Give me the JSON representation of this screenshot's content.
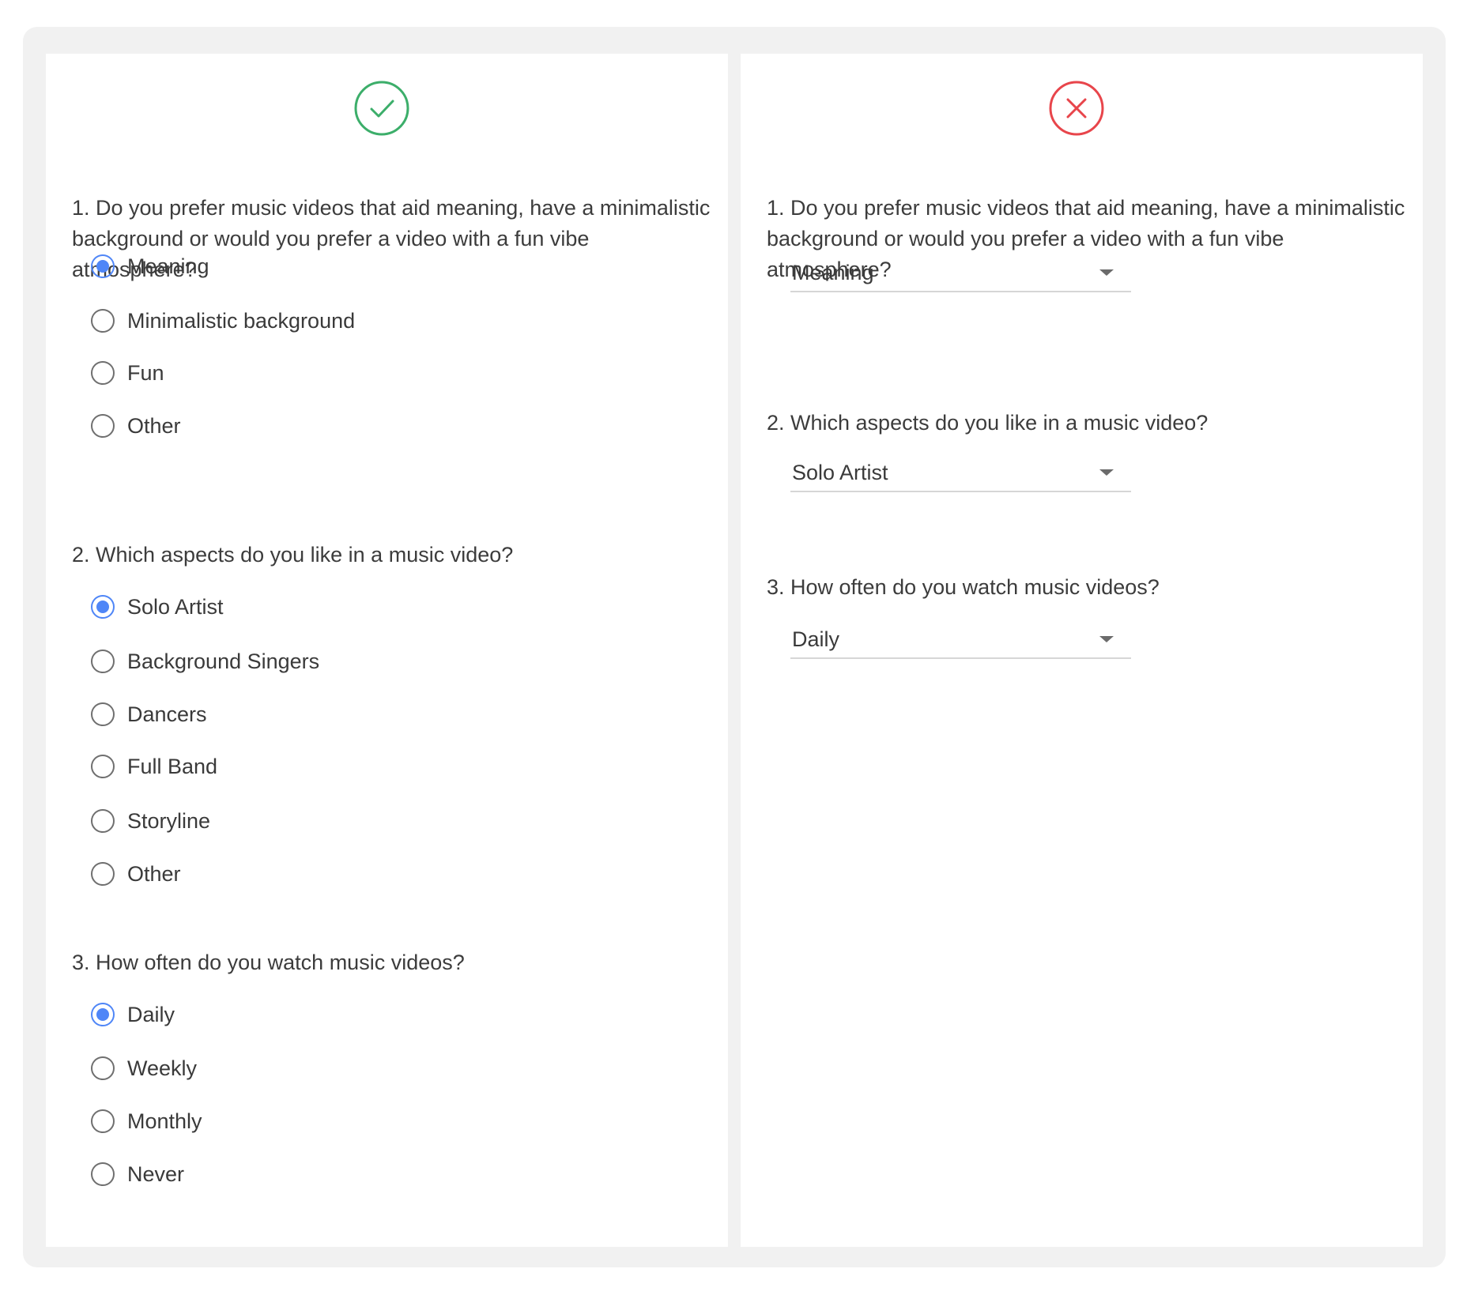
{
  "colors": {
    "check": "#3cae6a",
    "cross": "#e8454b",
    "radio_selected": "#4f86f7"
  },
  "good_panel": {
    "icon": "check-circle-icon",
    "questions": [
      {
        "text": "1. Do you prefer music videos that aid meaning, have a minimalistic background or would you prefer a video with a fun vibe atmosphere?",
        "options": [
          "Meaning",
          "Minimalistic background",
          "Fun",
          "Other"
        ],
        "selected": "Meaning"
      },
      {
        "text": "2. Which aspects do you like in a music video?",
        "options": [
          "Solo Artist",
          "Background Singers",
          "Dancers",
          "Full Band",
          "Storyline",
          "Other"
        ],
        "selected": "Solo Artist"
      },
      {
        "text": "3. How often do you watch music videos?",
        "options": [
          "Daily",
          "Weekly",
          "Monthly",
          "Never"
        ],
        "selected": "Daily"
      }
    ]
  },
  "bad_panel": {
    "icon": "x-circle-icon",
    "questions": [
      {
        "text": "1. Do you prefer music videos that aid meaning, have a minimalistic background or would you prefer a video with a fun vibe atmosphere?",
        "selected": "Meaning"
      },
      {
        "text": "2. Which aspects do you like in a music video?",
        "selected": "Solo Artist"
      },
      {
        "text": "3. How often do you watch music videos?",
        "selected": "Daily"
      }
    ]
  }
}
